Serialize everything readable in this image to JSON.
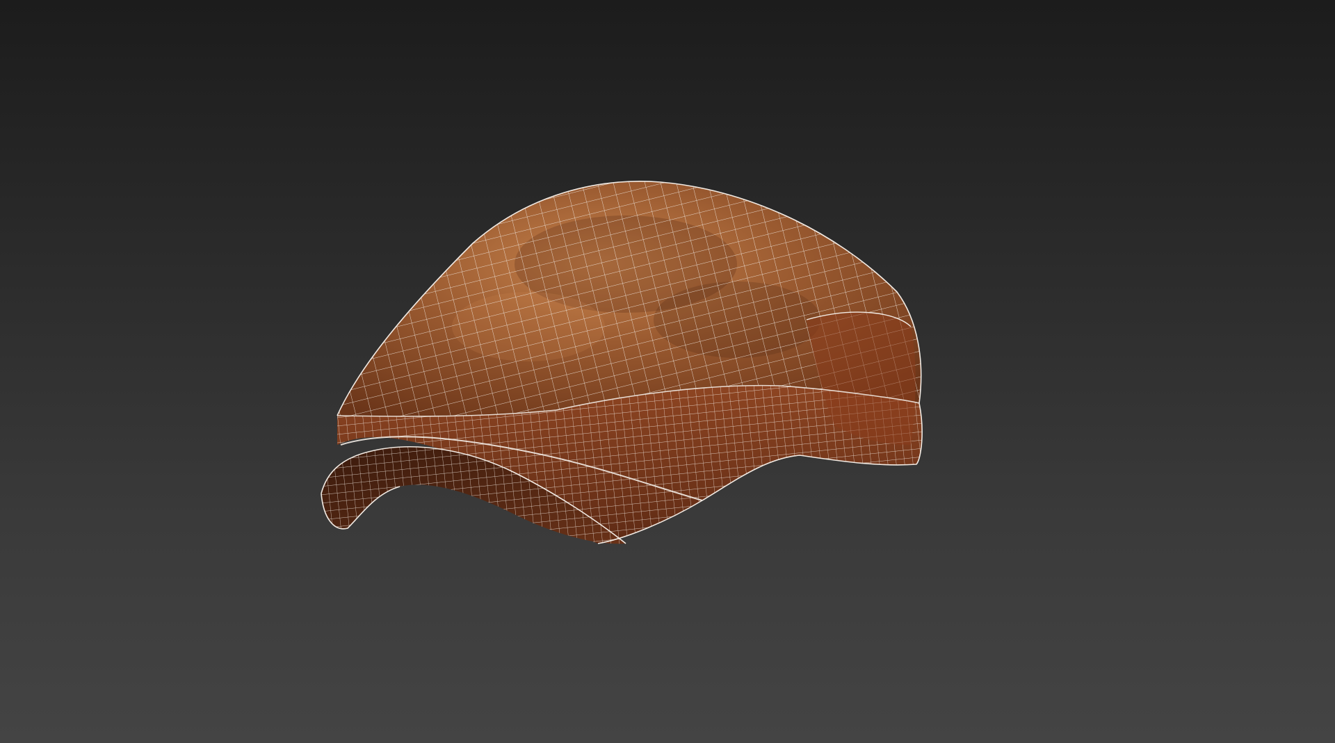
{
  "viewport": {
    "background_top": "#1c1c1c",
    "background_bottom": "#444444",
    "shading": "textured-with-wireframe-overlay"
  },
  "model": {
    "icon": "flat-cap-mesh-icon",
    "material_colors": {
      "base": "#9a5a30",
      "highlight": "#c4804a",
      "shadow": "#4a2412",
      "underside": "#5a2a16",
      "band": "#7e3a1e"
    },
    "wire_color": "#f2ebe4"
  }
}
